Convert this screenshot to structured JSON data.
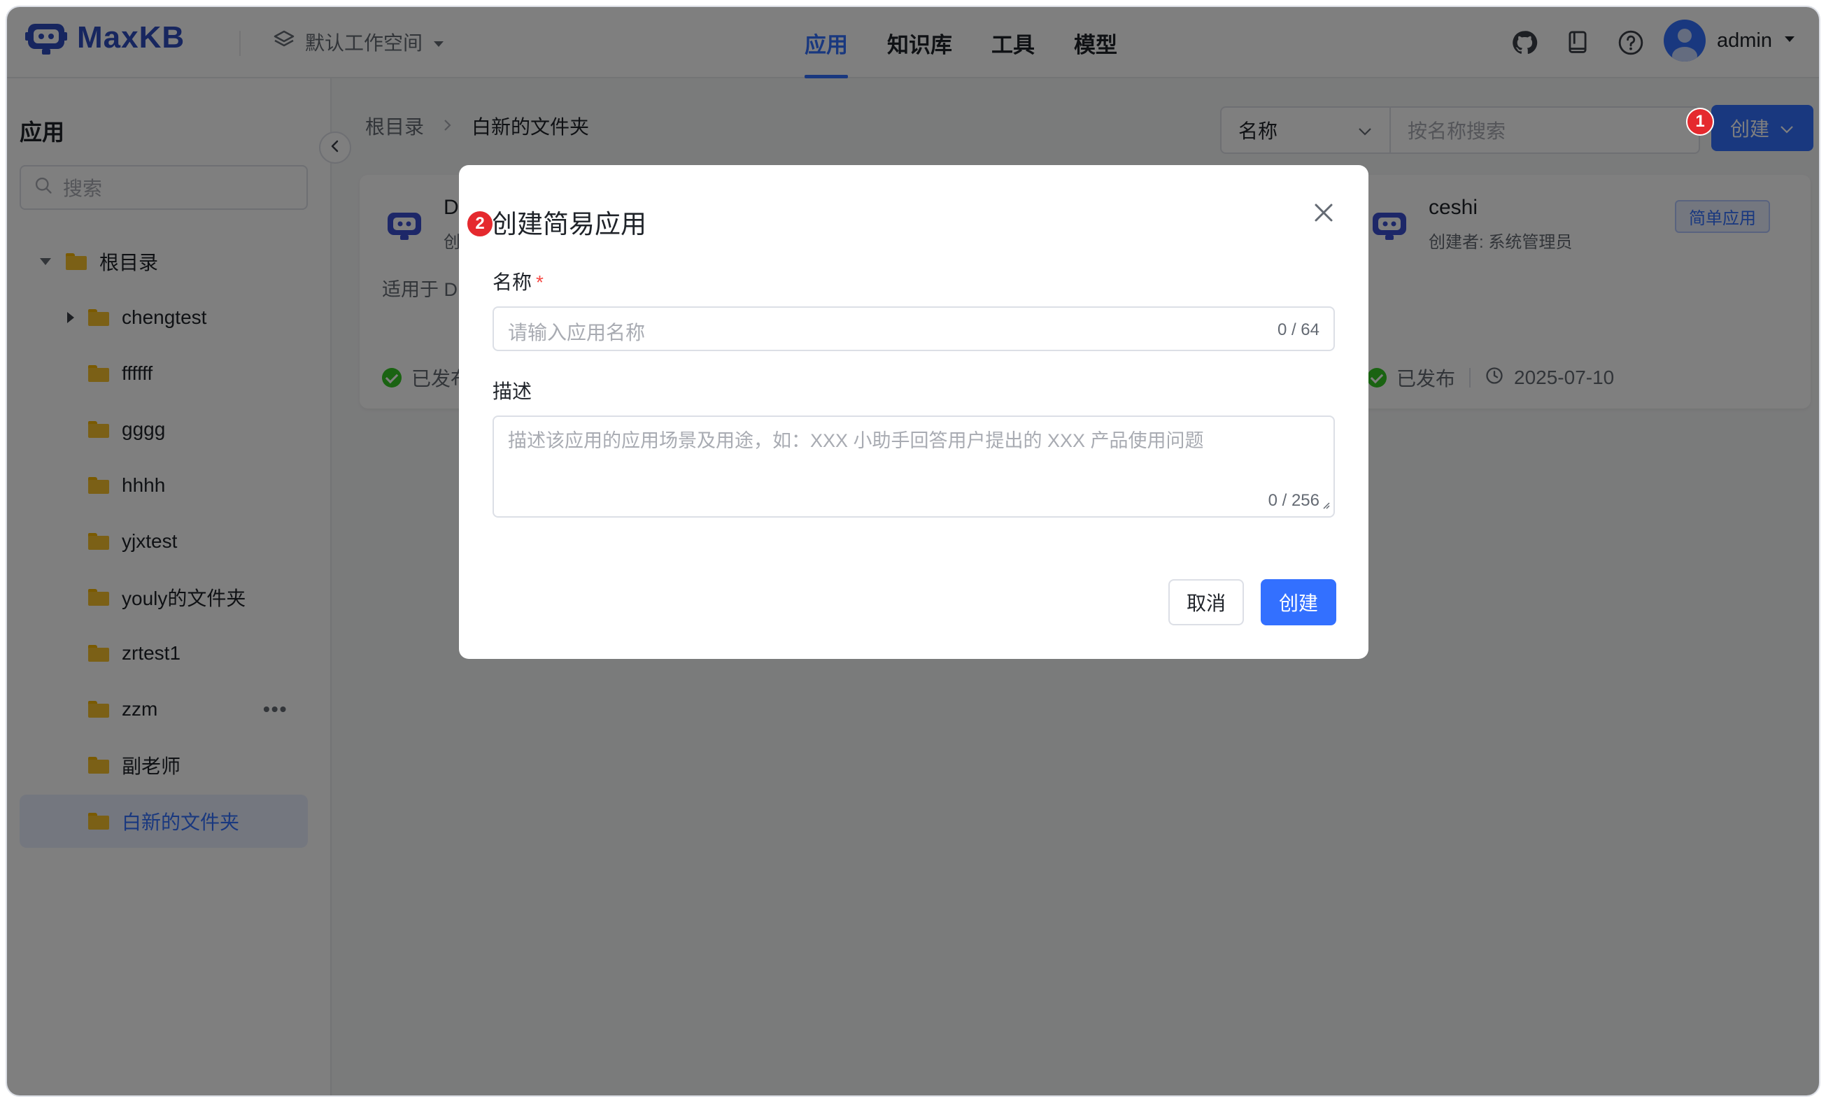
{
  "app": {
    "logo_text": "MaxKB",
    "workspace": "默认工作空间"
  },
  "nav": {
    "items": [
      "应用",
      "知识库",
      "工具",
      "模型"
    ],
    "active_index": 0
  },
  "header": {
    "icons": [
      "github-icon",
      "docs-icon",
      "help-icon"
    ],
    "user_name": "admin"
  },
  "sidebar": {
    "title": "应用",
    "search_placeholder": "搜索",
    "root_label": "根目录",
    "folders": [
      "chengtest",
      "ffffff",
      "gggg",
      "hhhh",
      "yjxtest",
      "youly的文件夹",
      "zrtest1",
      "zzm",
      "副老师",
      "白新的文件夹"
    ],
    "selected_folder": "白新的文件夹",
    "more_label": "•••"
  },
  "breadcrumb": {
    "root": "根目录",
    "current": "白新的文件夹"
  },
  "filter": {
    "select_value": "名称",
    "search_placeholder": "按名称搜索",
    "create_label": "创建"
  },
  "cards": [
    {
      "name": "Da",
      "creator": "创",
      "desc": "适用于 D",
      "status": "已发布"
    },
    {
      "name": "ceshi",
      "creator": "创建者: 系统管理员",
      "tag": "简单应用",
      "status": "已发布",
      "date": "2025-07-10"
    }
  ],
  "steps": {
    "one": "1",
    "two": "2"
  },
  "dialog": {
    "title": "创建简易应用",
    "name_label": "名称",
    "required_mark": "*",
    "name_placeholder": "请输入应用名称",
    "name_counter": "0 / 64",
    "desc_label": "描述",
    "desc_placeholder": "描述该应用的应用场景及用途，如：XXX 小助手回答用户提出的 XXX 产品使用问题",
    "desc_counter": "0 / 256",
    "cancel_label": "取消",
    "create_label": "创建"
  },
  "colors": {
    "primary": "#3370ff",
    "badge": "#e5292e",
    "folder": "#f7c12c",
    "logo": "#2e4dbf"
  }
}
